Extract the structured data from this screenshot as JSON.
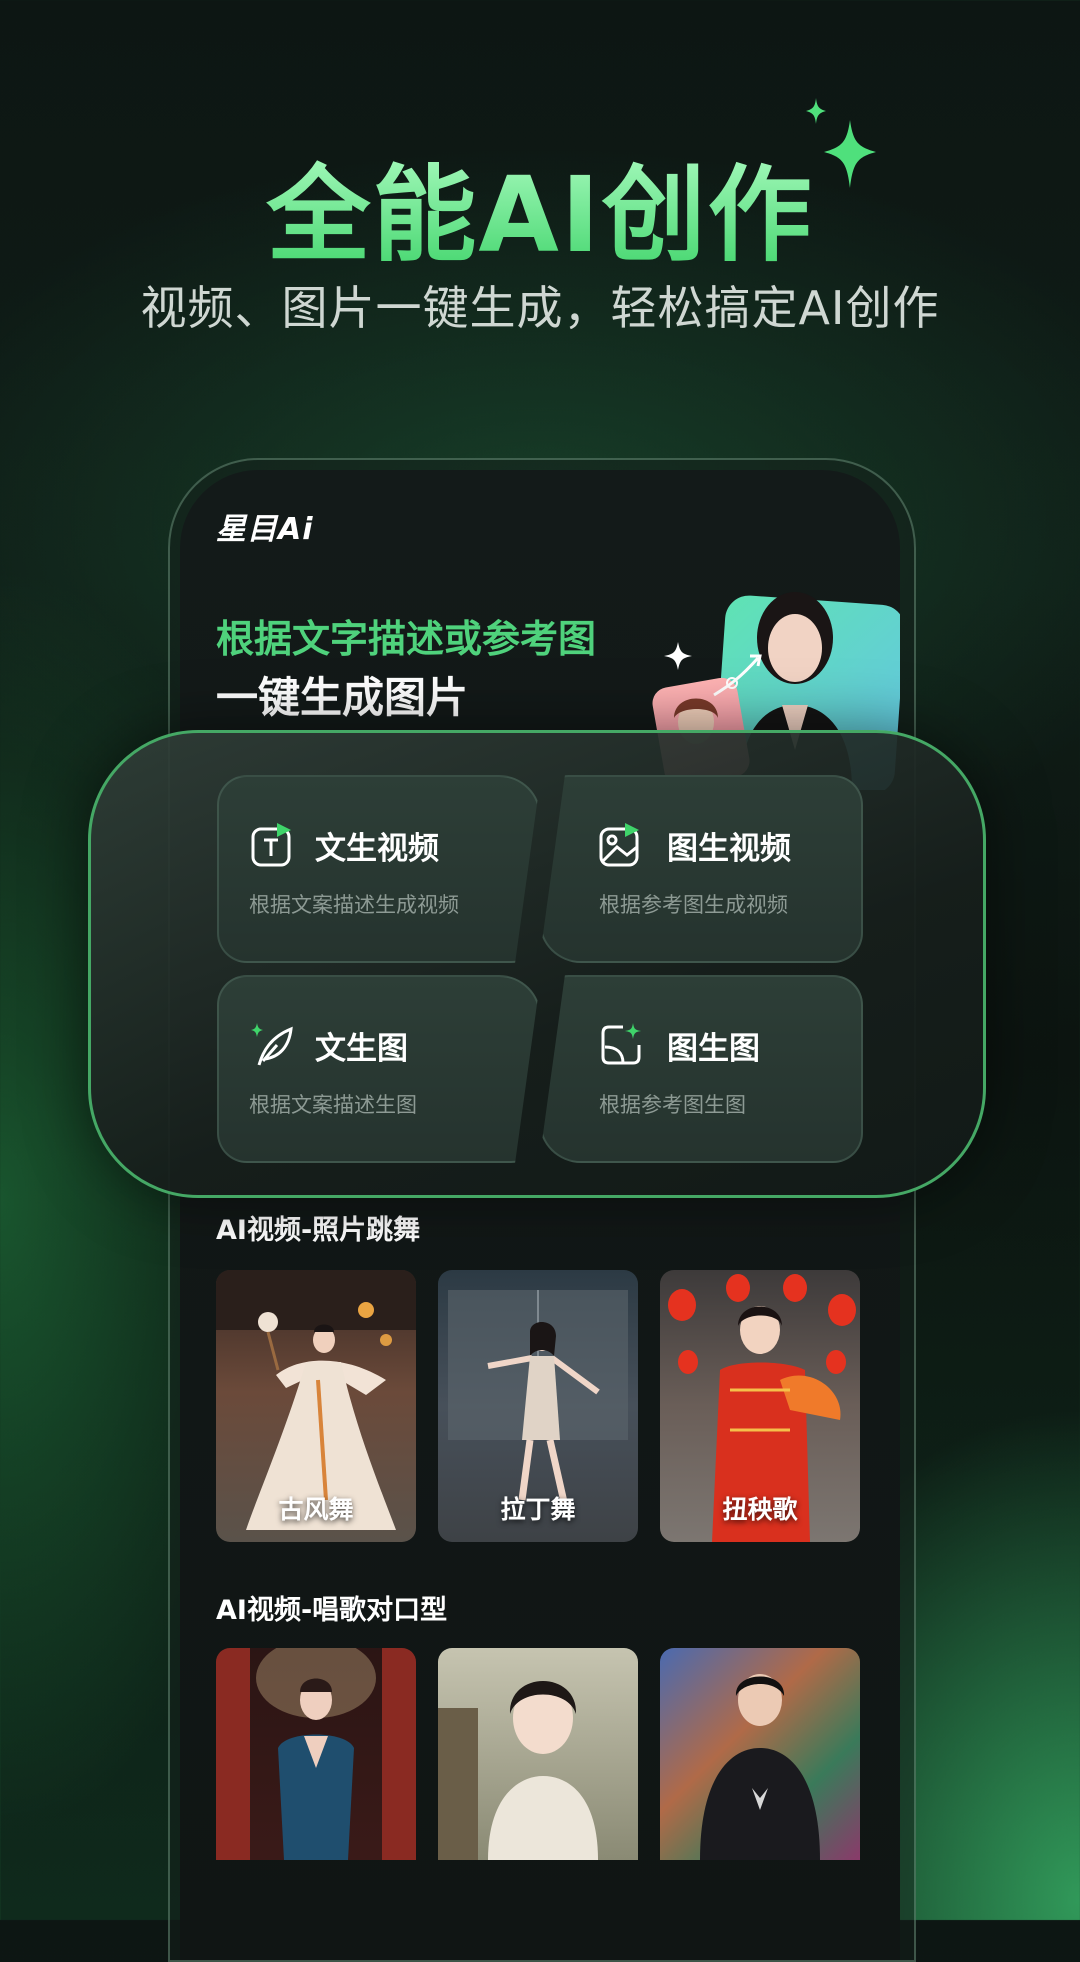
{
  "hero": {
    "title": "全能AI创作",
    "subtitle": "视频、图片一键生成，轻松搞定AI创作"
  },
  "app": {
    "logo": "星目Ai",
    "banner": {
      "line1": "根据文字描述或参考图",
      "line2": "一键生成图片"
    }
  },
  "features": [
    {
      "title": "文生视频",
      "desc": "根据文案描述生成视频",
      "icon": "text-video-icon"
    },
    {
      "title": "图生视频",
      "desc": "根据参考图生成视频",
      "icon": "image-video-icon"
    },
    {
      "title": "文生图",
      "desc": "根据文案描述生图",
      "icon": "feather-icon"
    },
    {
      "title": "图生图",
      "desc": "根据参考图生图",
      "icon": "image-to-image-icon"
    }
  ],
  "sections": [
    {
      "title": "AI视频-照片跳舞",
      "items": [
        {
          "label": "古风舞"
        },
        {
          "label": "拉丁舞"
        },
        {
          "label": "扭秧歌"
        }
      ]
    },
    {
      "title": "AI视频-唱歌对口型",
      "items": [
        {
          "label": ""
        },
        {
          "label": ""
        },
        {
          "label": ""
        }
      ]
    }
  ],
  "colors": {
    "accent": "#4fd27c",
    "panel_border": "#45a865"
  }
}
